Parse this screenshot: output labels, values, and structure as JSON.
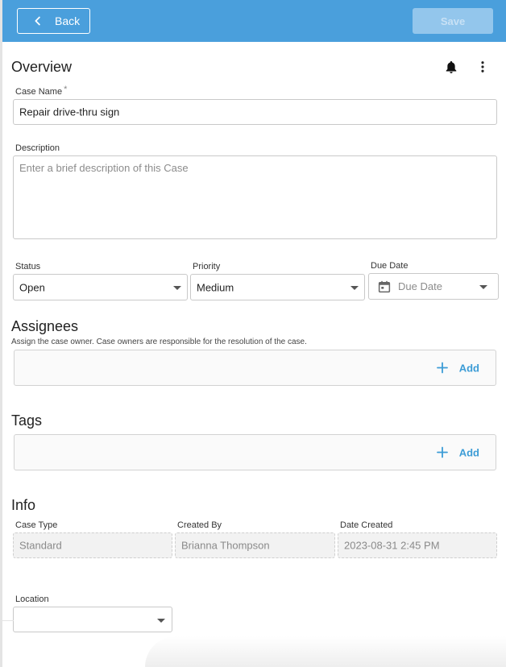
{
  "header": {
    "back_label": "Back",
    "save_label": "Save"
  },
  "overview": {
    "title": "Overview",
    "case_name_label": "Case Name",
    "required_mark": "*",
    "case_name_value": "Repair drive-thru sign",
    "description_label": "Description",
    "description_placeholder": "Enter a brief description of this Case",
    "status_label": "Status",
    "status_value": "Open",
    "priority_label": "Priority",
    "priority_value": "Medium",
    "due_date_label": "Due Date",
    "due_date_placeholder": "Due Date"
  },
  "assignees": {
    "title": "Assignees",
    "hint": "Assign the case owner. Case owners are responsible for the resolution of the case.",
    "add_label": "Add"
  },
  "tags": {
    "title": "Tags",
    "add_label": "Add"
  },
  "info": {
    "title": "Info",
    "case_type_label": "Case Type",
    "case_type_value": "Standard",
    "created_by_label": "Created By",
    "created_by_value": "Brianna Thompson",
    "date_created_label": "Date Created",
    "date_created_value": "2023-08-31 2:45 PM",
    "location_label": "Location",
    "location_value": ""
  },
  "icons": {
    "back": "chevron-left-icon",
    "bell": "bell-icon",
    "menu": "more-vertical-icon",
    "calendar": "calendar-icon",
    "add": "plus-icon"
  },
  "colors": {
    "header_bg": "#4a9fdc",
    "save_disabled_bg": "#93c6ec",
    "accent": "#3c9cd6"
  }
}
